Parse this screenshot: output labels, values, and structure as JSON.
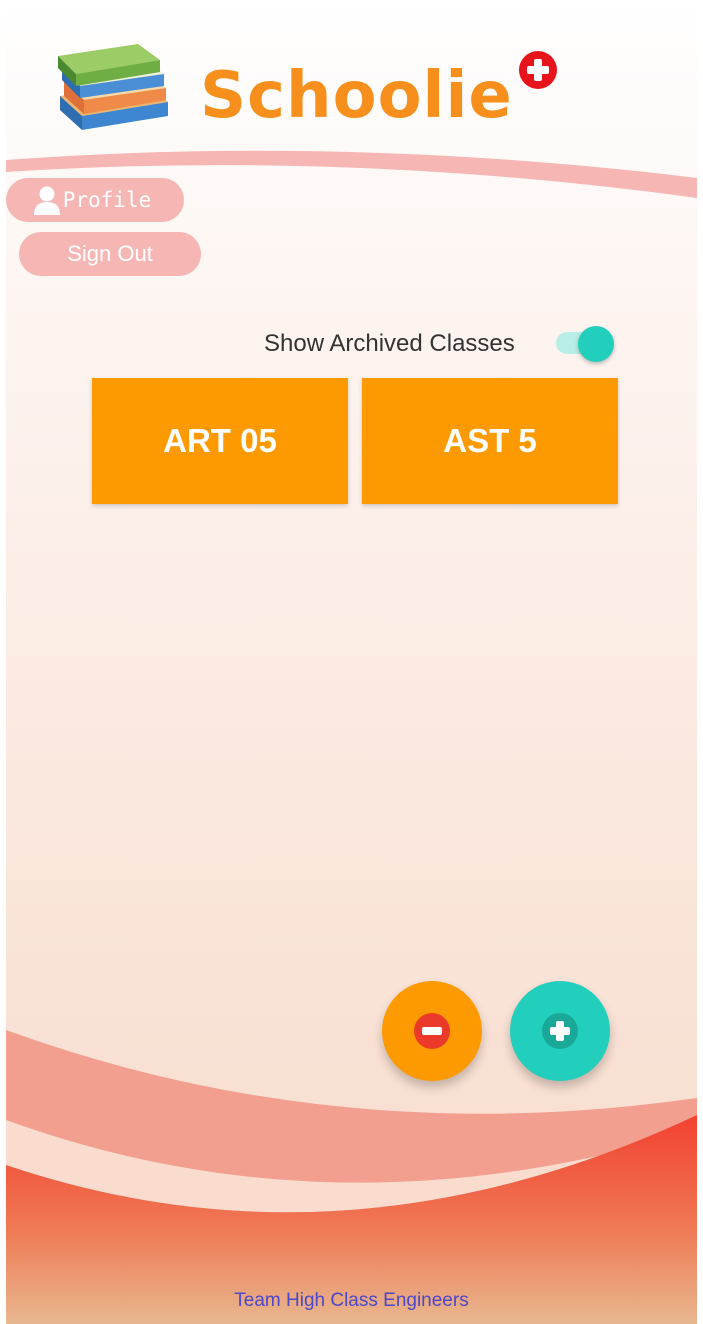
{
  "header": {
    "app_title": "Schoolie",
    "logo_icon": "books-stack-icon",
    "badge_icon": "plus-circle-icon"
  },
  "nav": {
    "profile_label": "Profile",
    "profile_icon": "person-icon",
    "signout_label": "Sign Out"
  },
  "archived_toggle": {
    "label": "Show Archived Classes",
    "state": "on"
  },
  "classes": [
    {
      "name": "ART 05"
    },
    {
      "name": "AST 5"
    }
  ],
  "fabs": {
    "remove_icon": "minus-circle-icon",
    "add_icon": "plus-circle-icon"
  },
  "footer": {
    "credit": "Team High Class Engineers"
  },
  "colors": {
    "title": "#f68f1c",
    "tile": "#fd9a01",
    "accent_teal": "#22cebc",
    "pill": "#f6b6b4",
    "footer_text": "#4b48c9",
    "footer_red": "#f24130"
  }
}
